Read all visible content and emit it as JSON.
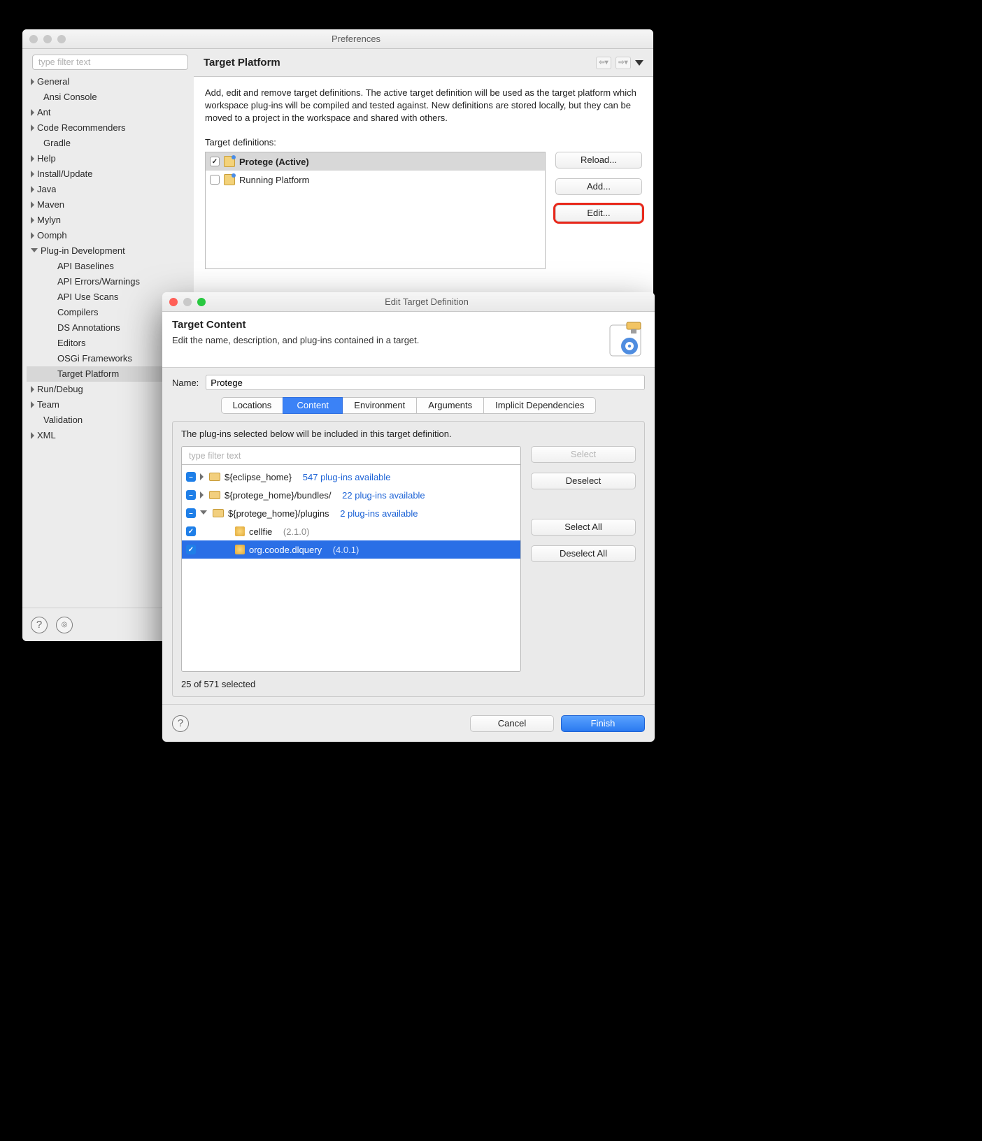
{
  "prefs": {
    "title": "Preferences",
    "filter_placeholder": "type filter text",
    "tree": {
      "general": "General",
      "ansi": "Ansi Console",
      "ant": "Ant",
      "coderec": "Code Recommenders",
      "gradle": "Gradle",
      "help": "Help",
      "install": "Install/Update",
      "java": "Java",
      "maven": "Maven",
      "mylyn": "Mylyn",
      "oomph": "Oomph",
      "pde": "Plug-in Development",
      "pde_api_baselines": "API Baselines",
      "pde_api_errors": "API Errors/Warnings",
      "pde_api_use": "API Use Scans",
      "pde_compilers": "Compilers",
      "pde_ds": "DS Annotations",
      "pde_editors": "Editors",
      "pde_osgi": "OSGi Frameworks",
      "pde_target": "Target Platform",
      "rundebug": "Run/Debug",
      "team": "Team",
      "validation": "Validation",
      "xml": "XML"
    },
    "page_title": "Target Platform",
    "description": "Add, edit and remove target definitions.  The active target definition will be used as the target platform which workspace plug-ins will be compiled and tested against.  New definitions are stored locally, but they can be moved to a project in the workspace and shared with others.",
    "defs_label": "Target definitions:",
    "defs": {
      "protege": "Protege (Active)",
      "running": "Running Platform"
    },
    "buttons": {
      "reload": "Reload...",
      "add": "Add...",
      "edit": "Edit..."
    }
  },
  "edit": {
    "title": "Edit Target Definition",
    "banner_title": "Target Content",
    "banner_sub": "Edit the name, description, and plug-ins contained in a target.",
    "name_label": "Name:",
    "name_value": "Protege",
    "tabs": {
      "locations": "Locations",
      "content": "Content",
      "environment": "Environment",
      "arguments": "Arguments",
      "implicit": "Implicit Dependencies"
    },
    "hint": "The plug-ins selected below will be included in this target definition.",
    "filter_placeholder": "type filter text",
    "items": {
      "eclipse_home": "${eclipse_home}",
      "eclipse_home_note": "547 plug-ins available",
      "protege_bundles": "${protege_home}/bundles/",
      "protege_bundles_note": "22 plug-ins available",
      "protege_plugins": "${protege_home}/plugins",
      "protege_plugins_note": "2 plug-ins available",
      "cellfie": "cellfie",
      "cellfie_ver": "(2.1.0)",
      "dlquery": "org.coode.dlquery",
      "dlquery_ver": "(4.0.1)"
    },
    "buttons": {
      "select": "Select",
      "deselect": "Deselect",
      "select_all": "Select All",
      "deselect_all": "Deselect All",
      "cancel": "Cancel",
      "finish": "Finish"
    },
    "count_label": "25 of 571 selected"
  }
}
